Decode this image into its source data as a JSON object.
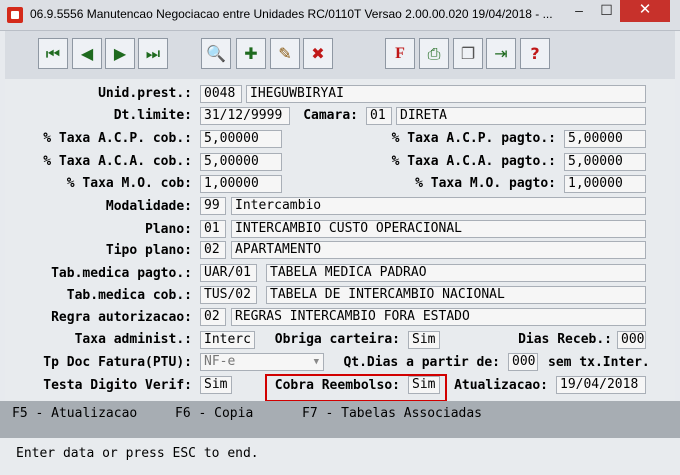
{
  "window": {
    "title": "06.9.5556 Manutencao  Negociacao entre Unidades RC/0110T Versao 2.00.00.020 19/04/2018 - ...",
    "minimize": "–",
    "maximize": "☐",
    "close": "✕"
  },
  "toolbar": {
    "first_icon": "⏮",
    "prev_icon": "◀",
    "next_icon": "▶",
    "last_icon": "⏭",
    "search_icon": "🔍",
    "add_icon": "✚",
    "edit_icon": "✎",
    "delete_icon": "✖",
    "filter_icon": "F",
    "print_icon": "⎙",
    "copy_icon": "❐",
    "exit_icon": "⇥",
    "help_icon": "?"
  },
  "form": {
    "unid_prest": {
      "label": "Unid.prest.:",
      "code": "0048",
      "name": "IHEGUWBIRYAI"
    },
    "dt_limite": {
      "label": "Dt.limite:",
      "value": "31/12/9999"
    },
    "camara": {
      "label": "Camara:",
      "code": "01",
      "name": "DIRETA"
    },
    "taxa_acp_cob": {
      "label": "% Taxa A.C.P. cob.:",
      "value": "5,00000"
    },
    "taxa_acp_pagto": {
      "label": "% Taxa A.C.P. pagto.:",
      "value": "5,00000"
    },
    "taxa_aca_cob": {
      "label": "% Taxa A.C.A. cob.:",
      "value": "5,00000"
    },
    "taxa_aca_pagto": {
      "label": "% Taxa A.C.A. pagto.:",
      "value": "5,00000"
    },
    "taxa_mo_cob": {
      "label": "% Taxa M.O. cob:",
      "value": "1,00000"
    },
    "taxa_mo_pagto": {
      "label": "% Taxa M.O. pagto:",
      "value": "1,00000"
    },
    "modalidade": {
      "label": "Modalidade:",
      "code": "99",
      "name": "Intercambio"
    },
    "plano": {
      "label": "Plano:",
      "code": "01",
      "name": "INTERCAMBIO CUSTO OPERACIONAL"
    },
    "tipo_plano": {
      "label": "Tipo plano:",
      "code": "02",
      "name": "APARTAMENTO"
    },
    "tab_medica_pagto": {
      "label": "Tab.medica pagto.:",
      "code": "UAR/01",
      "name": "TABELA MEDICA PADRAO"
    },
    "tab_medica_cob": {
      "label": "Tab.medica cob.:",
      "code": "TUS/02",
      "name": "TABELA DE INTERCAMBIO NACIONAL"
    },
    "regra_autorizacao": {
      "label": "Regra autorizacao:",
      "code": "02",
      "name": "REGRAS INTERCAMBIO FORA ESTADO"
    },
    "taxa_administ": {
      "label": "Taxa administ.:",
      "value": "Interc"
    },
    "obriga_carteira": {
      "label": "Obriga carteira:",
      "value": "Sim"
    },
    "dias_receb": {
      "label": "Dias Receb.:",
      "value": "000"
    },
    "tp_doc_fatura": {
      "label": "Tp Doc Fatura(PTU):",
      "value": "NF-e",
      "arrow": "▼"
    },
    "qt_dias": {
      "label": "Qt.Dias a partir de:",
      "value": "000",
      "suffix": "sem tx.Inter."
    },
    "testa_digito": {
      "label": "Testa Digito Verif:",
      "value": "Sim"
    },
    "cobra_reembolso": {
      "label": "Cobra Reembolso:",
      "value": "Sim"
    },
    "atualizacao": {
      "label": "Atualizacao:",
      "value": "19/04/2018"
    }
  },
  "fkeys": {
    "f5": "F5 - Atualizacao",
    "f6": "F6 - Copia",
    "f7": "F7 - Tabelas Associadas"
  },
  "status": "Enter data or press ESC to end.",
  "colors": {
    "highlight": "#d10000",
    "fkey_bar": "#a7adb3"
  }
}
